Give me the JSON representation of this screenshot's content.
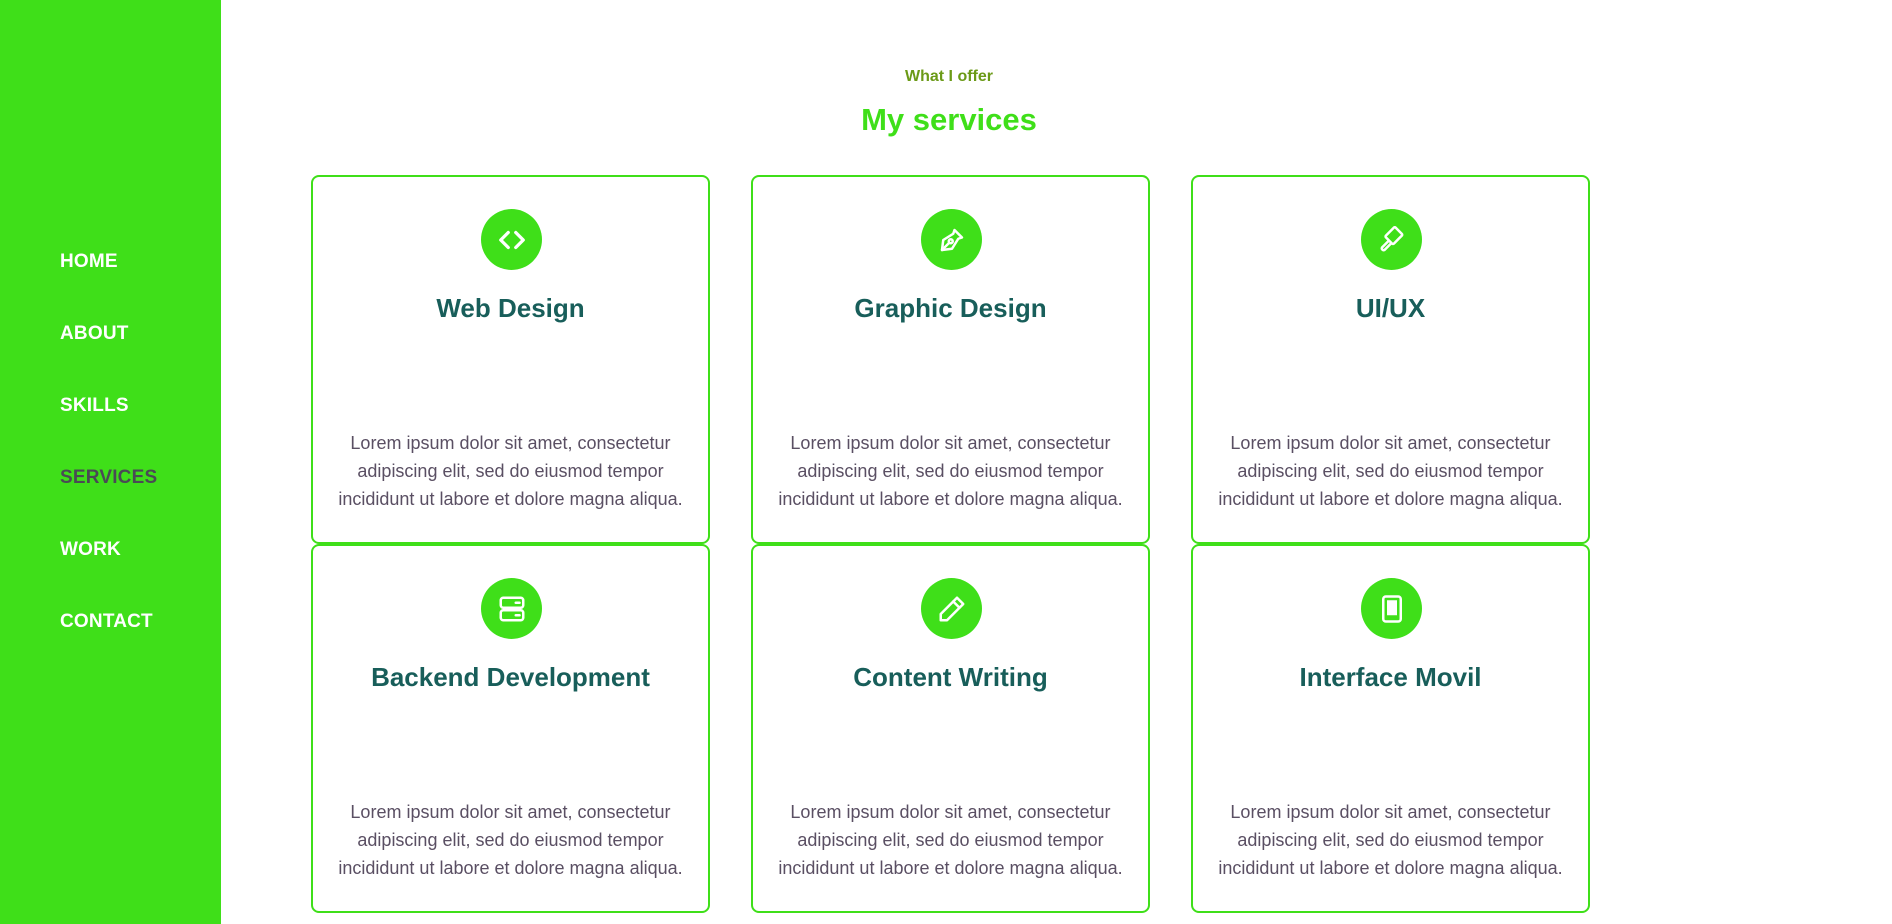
{
  "nav": {
    "items": [
      {
        "label": "HOME"
      },
      {
        "label": "ABOUT"
      },
      {
        "label": "SKILLS"
      },
      {
        "label": "SERVICES",
        "active": true
      },
      {
        "label": "WORK"
      },
      {
        "label": "CONTACT"
      }
    ]
  },
  "section": {
    "subtitle": "What I offer",
    "title": "My services"
  },
  "services": [
    {
      "icon": "code-icon",
      "title": "Web Design",
      "text": "Lorem ipsum dolor sit amet, consectetur adipiscing elit, sed do eiusmod tempor incididunt ut labore et dolore magna aliqua."
    },
    {
      "icon": "pen-nib-icon",
      "title": "Graphic Design",
      "text": "Lorem ipsum dolor sit amet, consectetur adipiscing elit, sed do eiusmod tempor incididunt ut labore et dolore magna aliqua."
    },
    {
      "icon": "paint-brush-icon",
      "title": "UI/UX",
      "text": "Lorem ipsum dolor sit amet, consectetur adipiscing elit, sed do eiusmod tempor incididunt ut labore et dolore magna aliqua."
    },
    {
      "icon": "server-icon",
      "title": "Backend Development",
      "text": "Lorem ipsum dolor sit amet, consectetur adipiscing elit, sed do eiusmod tempor incididunt ut labore et dolore magna aliqua."
    },
    {
      "icon": "pencil-icon",
      "title": "Content Writing",
      "text": "Lorem ipsum dolor sit amet, consectetur adipiscing elit, sed do eiusmod tempor incididunt ut labore et dolore magna aliqua."
    },
    {
      "icon": "tablet-icon",
      "title": "Interface Movil",
      "text": "Lorem ipsum dolor sit amet, consectetur adipiscing elit, sed do eiusmod tempor incididunt ut labore et dolore magna aliqua."
    }
  ],
  "colors": {
    "accent": "#3fdf19",
    "heading": "#185e5a",
    "body_text": "#5a4f63",
    "subtitle": "#6b9a17",
    "nav_active": "#4a4a55"
  }
}
